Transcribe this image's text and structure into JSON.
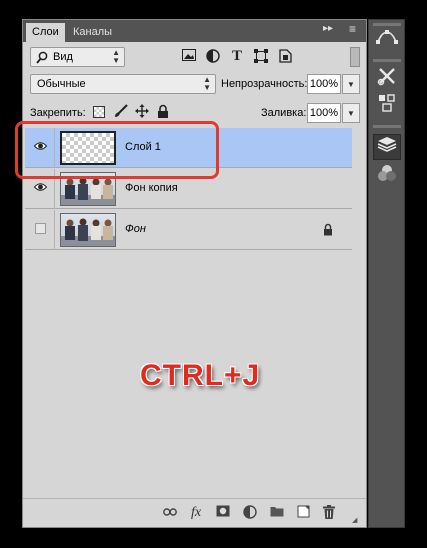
{
  "panel": {
    "tabs": [
      {
        "label": "Слои",
        "active": true
      },
      {
        "label": "Каналы",
        "active": false
      }
    ],
    "tab_buttons": {
      "collapse": "▸▸",
      "menu": "≡"
    }
  },
  "filter": {
    "label": "Вид",
    "icon": "search-icon",
    "arrow": "⇕"
  },
  "filter_icons": [
    "image-filter-icon",
    "adjustment-filter-icon",
    "type-filter-icon",
    "shape-filter-icon",
    "smart-object-filter-icon"
  ],
  "blend_mode": {
    "value": "Обычные",
    "arrow": "⇕"
  },
  "opacity": {
    "label": "Непрозрачность:",
    "value": "100%"
  },
  "lock": {
    "label": "Закрепить:",
    "icons": [
      "lock-transparency-icon",
      "lock-image-icon",
      "lock-position-icon",
      "lock-all-icon"
    ]
  },
  "fill": {
    "label": "Заливка:",
    "value": "100%"
  },
  "layers": [
    {
      "name": "Слой 1",
      "visible": true,
      "selected": true,
      "thumb": "transparent",
      "locked": false,
      "italic": false
    },
    {
      "name": "Фон копия",
      "visible": true,
      "selected": false,
      "thumb": "photo",
      "locked": false,
      "italic": false
    },
    {
      "name": "Фон",
      "visible": false,
      "selected": false,
      "thumb": "photo",
      "locked": true,
      "italic": true
    }
  ],
  "overlay_text": "CTRL+J",
  "bottom_icons": [
    "link-layers-icon",
    "fx-icon",
    "layer-mask-icon",
    "adjustment-layer-icon",
    "new-group-icon",
    "new-layer-icon",
    "delete-layer-icon"
  ],
  "bottom_labels": {
    "fx": "fx"
  },
  "dock_icons": [
    "curves-icon",
    "tools-icon",
    "3d-icon",
    "layers-icon",
    "channels-icon"
  ],
  "colors": {
    "selection": "#a9c6f4",
    "highlight": "#e03b30",
    "overlay": "#e02a1f",
    "panel": "#d6d6d6",
    "tabbar": "#535353"
  }
}
